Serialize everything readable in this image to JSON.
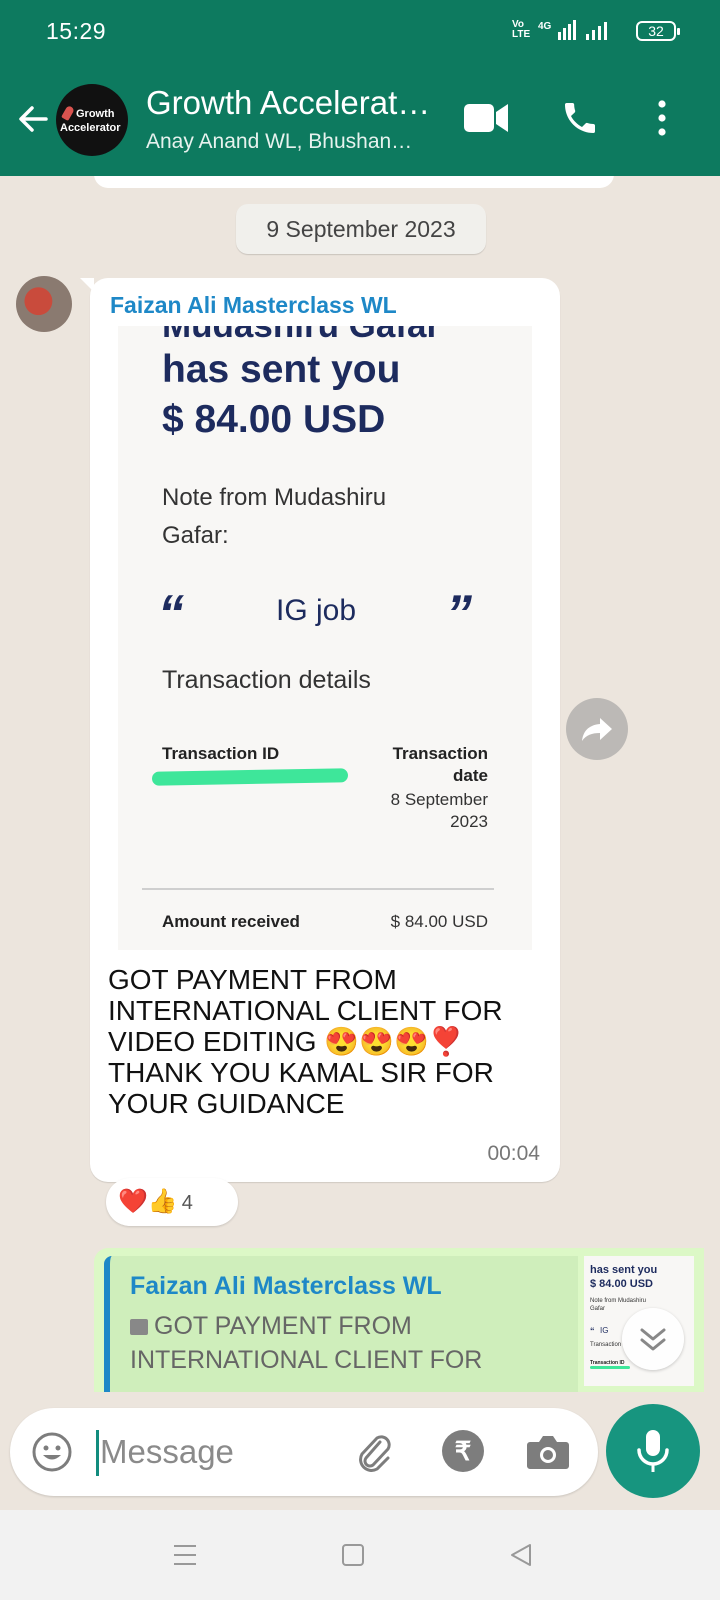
{
  "status_bar": {
    "time": "15:29",
    "network": "4G",
    "volte": "VoLTE",
    "battery": "32"
  },
  "header": {
    "group_name": "Growth Accelerat…",
    "participants": "Anay Anand WL, Bhushan…",
    "avatar_line1": "Growth",
    "avatar_line2": "Accelerator",
    "icons": [
      "back-arrow-icon",
      "video-call-icon",
      "voice-call-icon",
      "more-options-icon"
    ]
  },
  "chat": {
    "date_separator": "9 September 2023",
    "message": {
      "sender": "Faizan Ali Masterclass WL",
      "image": {
        "cut_top_text": "Mudashiru Gafar",
        "headline_1": "has sent you",
        "headline_2": "$ 84.00 USD",
        "note_line_1": "Note from Mudashiru",
        "note_line_2": "Gafar:",
        "open_quote": "“",
        "close_quote": "”",
        "note_text": "IG job",
        "section_title": "Transaction details",
        "txn_id_label": "Transaction ID",
        "txn_date_label_1": "Transaction",
        "txn_date_label_2": "date",
        "txn_date_value_1": "8 September",
        "txn_date_value_2": "2023",
        "amount_label": "Amount received",
        "amount_value": "$ 84.00 USD"
      },
      "text_lines": [
        "GOT PAYMENT FROM",
        "INTERNATIONAL CLIENT FOR",
        "VIDEO EDITING 😍😍😍❣️",
        "THANK YOU KAMAL SIR FOR",
        "YOUR GUIDANCE"
      ],
      "time": "00:04",
      "reactions": {
        "emojis": "❤️👍",
        "count": "4"
      }
    },
    "reply": {
      "quoted_sender": "Faizan Ali Masterclass WL",
      "quoted_line_1": "GOT PAYMENT FROM",
      "quoted_line_2": "INTERNATIONAL CLIENT FOR",
      "thumb": {
        "l1": "has sent you",
        "l2": "$ 84.00 USD",
        "l3": "Note from Mudashiru",
        "l4": "Gafar",
        "l5": "“",
        "l6": "IG",
        "l7": "Transaction",
        "l8": "Transaction ID"
      }
    }
  },
  "input": {
    "placeholder": "Message",
    "rupee_symbol": "₹"
  },
  "colors": {
    "header": "#0d7a5f",
    "accent": "#17957f",
    "sender_name": "#1e88c7",
    "chat_bg": "#ece5dd",
    "outgoing_bubble": "#dcf8c6"
  }
}
